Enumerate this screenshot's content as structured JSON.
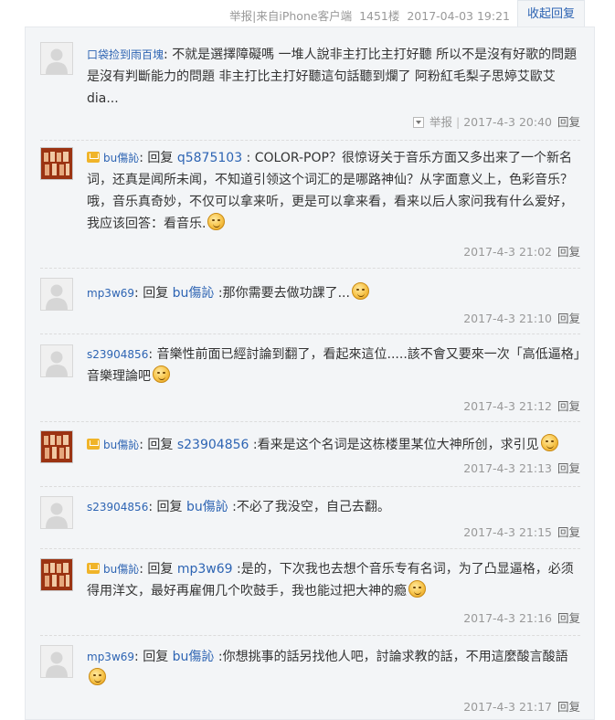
{
  "header": {
    "report_label": "举报",
    "source_label": "来自iPhone客户端",
    "floor": "1451楼",
    "datetime": "2017-04-03 19:21",
    "collapse_label": "收起回复"
  },
  "comments": [
    {
      "avatar": "default",
      "vip": false,
      "user": "口袋捡到雨百塊",
      "reply_word": "",
      "reply_to": "",
      "text": "不就是選擇障礙嗎 一堆人說非主打比主打好聽 所以不是沒有好歌的問題 是沒有判斷能力的問題 非主打比主打好聽這句話聽到爛了 阿粉紅毛梨子思婷艾歐艾dia...",
      "emoji": "",
      "report": "举报",
      "time": "2017-4-3 20:40",
      "reply": "回复"
    },
    {
      "avatar": "vip",
      "vip": true,
      "user": "bu傷訫",
      "reply_word": "回复",
      "reply_to": "q5875103",
      "text": "COLOR-POP？很惊讶关于音乐方面又多出来了一个新名词，还真是闻所未闻，不知道引领这个词汇的是哪路神仙？从字面意义上，色彩音乐？哦，音乐真奇妙，不仅可以拿来听，更是可以拿来看，看来以后人家问我有什么爱好，我应该回答：看音乐.",
      "emoji": "smile-emoji",
      "time": "2017-4-3 21:02",
      "reply": "回复"
    },
    {
      "avatar": "default",
      "vip": false,
      "user": "mp3w69",
      "reply_word": "回复",
      "reply_to": "bu傷訫",
      "text": "那你需要去做功課了...",
      "emoji": "smile-emoji",
      "time": "2017-4-3 21:10",
      "reply": "回复"
    },
    {
      "avatar": "default",
      "vip": false,
      "user": "s23904856",
      "reply_word": "",
      "reply_to": "",
      "text": "音樂性前面已經討論到翻了，看起來這位.....該不會又要來一次「高低逼格」音樂理論吧",
      "emoji": "sleepy-emoji",
      "time": "2017-4-3 21:12",
      "reply": "回复"
    },
    {
      "avatar": "vip",
      "vip": true,
      "user": "bu傷訫",
      "reply_word": "回复",
      "reply_to": "s23904856",
      "text": "看来是这个名词是这栋楼里某位大神所创，求引见",
      "emoji": "smile-emoji",
      "time": "2017-4-3 21:13",
      "reply": "回复"
    },
    {
      "avatar": "default",
      "vip": false,
      "user": "s23904856",
      "reply_word": "回复",
      "reply_to": "bu傷訫",
      "text": "不必了我没空，自己去翻。",
      "emoji": "",
      "time": "2017-4-3 21:15",
      "reply": "回复"
    },
    {
      "avatar": "vip",
      "vip": true,
      "user": "bu傷訫",
      "reply_word": "回复",
      "reply_to": "mp3w69",
      "text": "是的，下次我也去想个音乐专有名词，为了凸显逼格，必须得用洋文，最好再雇佣几个吹鼓手，我也能过把大神的瘾",
      "emoji": "smile-emoji",
      "time": "2017-4-3 21:16",
      "reply": "回复"
    },
    {
      "avatar": "default",
      "vip": false,
      "user": "mp3w69",
      "reply_word": "回复",
      "reply_to": "bu傷訫",
      "text": "你想挑事的話另找他人吧，討論求教的話，不用這麼酸言酸語",
      "emoji": "smile-emoji",
      "time": "2017-4-3 21:17",
      "reply": "回复"
    }
  ]
}
